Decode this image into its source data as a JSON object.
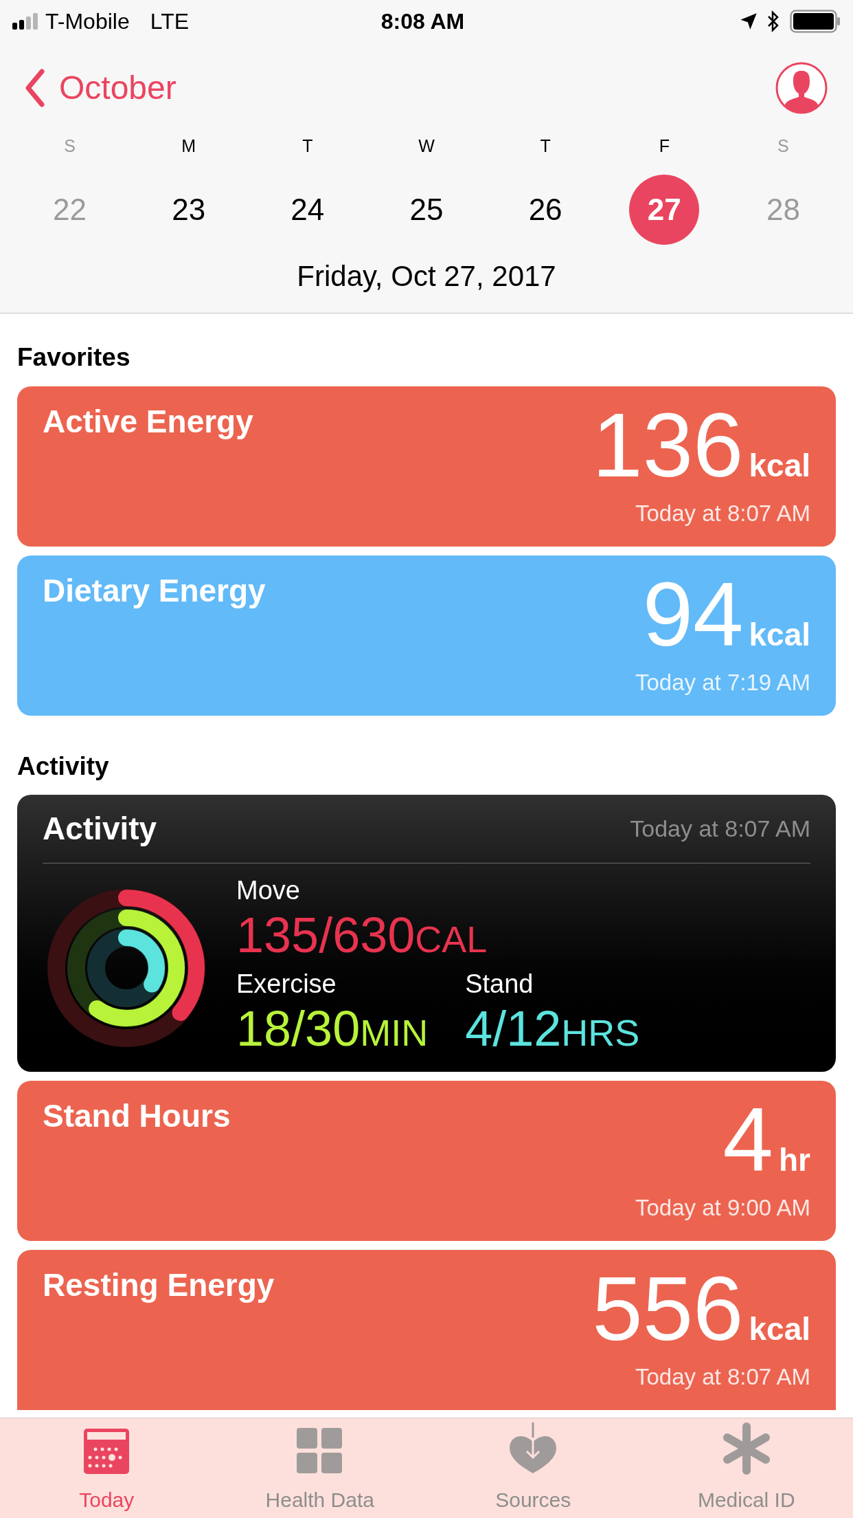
{
  "status_bar": {
    "carrier": "T-Mobile",
    "network": "LTE",
    "time": "8:08 AM"
  },
  "nav": {
    "back_label": "October"
  },
  "week": [
    {
      "letter": "S",
      "date": "22",
      "dimmed": true,
      "selected": false
    },
    {
      "letter": "M",
      "date": "23",
      "dimmed": false,
      "selected": false
    },
    {
      "letter": "T",
      "date": "24",
      "dimmed": false,
      "selected": false
    },
    {
      "letter": "W",
      "date": "25",
      "dimmed": false,
      "selected": false
    },
    {
      "letter": "T",
      "date": "26",
      "dimmed": false,
      "selected": false
    },
    {
      "letter": "F",
      "date": "27",
      "dimmed": false,
      "selected": true
    },
    {
      "letter": "S",
      "date": "28",
      "dimmed": true,
      "selected": false
    }
  ],
  "date_title": "Friday, Oct 27, 2017",
  "sections": [
    {
      "heading": "Favorites",
      "cards": [
        {
          "kind": "metric",
          "title": "Active Energy",
          "value": "136",
          "unit": "kcal",
          "time": "Today at 8:07 AM",
          "color": "#ec6450"
        },
        {
          "kind": "metric",
          "title": "Dietary Energy",
          "value": "94",
          "unit": "kcal",
          "time": "Today at 7:19 AM",
          "color": "#62baf8"
        }
      ]
    },
    {
      "heading": "Activity",
      "cards": [
        {
          "kind": "activity",
          "title": "Activity",
          "time": "Today at 8:07 AM",
          "rings": [
            {
              "label": "Move",
              "value": "135/630",
              "unit": "CAL",
              "color": "#e8334f",
              "level": 0.36
            },
            {
              "label": "Exercise",
              "value": "18/30",
              "unit": "MIN",
              "color": "#b8f33a",
              "level": 0.6
            },
            {
              "label": "Stand",
              "value": "4/12",
              "unit": "HRS",
              "color": "#5ce3de",
              "level": 0.34
            }
          ]
        },
        {
          "kind": "metric",
          "title": "Stand Hours",
          "value": "4",
          "unit": "hr",
          "time": "Today at 9:00 AM",
          "color": "#ec6450"
        },
        {
          "kind": "metric",
          "title": "Resting Energy",
          "value": "556",
          "unit": "kcal",
          "time": "Today at 8:07 AM",
          "color": "#ec6450"
        }
      ]
    }
  ],
  "tabs": [
    {
      "label": "Today",
      "selected": true
    },
    {
      "label": "Health Data",
      "selected": false
    },
    {
      "label": "Sources",
      "selected": false
    },
    {
      "label": "Medical ID",
      "selected": false
    }
  ]
}
